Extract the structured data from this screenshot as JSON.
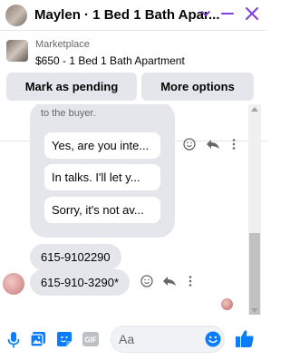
{
  "header": {
    "title": "Maylen · 1 Bed 1 Bath Apar...",
    "icons": [
      "chevron-down-icon",
      "minimize-icon",
      "close-icon"
    ],
    "accent": "#7b3fe4"
  },
  "marketplace": {
    "label": "Marketplace",
    "listing": "$650 - 1 Bed 1 Bath Apartment",
    "buttons": {
      "mark_pending": "Mark as pending",
      "more_options": "More options"
    }
  },
  "messages": {
    "partial_text": "to the buyer.",
    "quick_replies": [
      "Yes, are you inte...",
      "In talks. I'll let y...",
      "Sorry, it's not av..."
    ],
    "sent_1": "615-9102290",
    "sent_2": "615-910-3290*"
  },
  "composer": {
    "placeholder": "Aa",
    "icons": [
      "microphone-icon",
      "photo-icon",
      "sticker-icon",
      "gif-icon",
      "emoji-icon",
      "thumbs-up-icon"
    ],
    "gif_label": "GIF",
    "accent": "#0a7cff"
  }
}
